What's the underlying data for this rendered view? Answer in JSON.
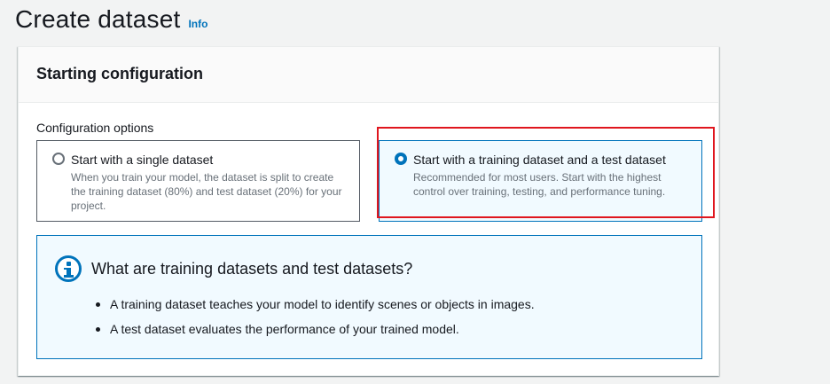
{
  "header": {
    "title": "Create dataset",
    "info_label": "Info"
  },
  "container": {
    "title": "Starting configuration"
  },
  "config": {
    "label": "Configuration options",
    "options": [
      {
        "title": "Start with a single dataset",
        "description": "When you train your model, the dataset is split to create the training dataset (80%) and test dataset (20%) for your project.",
        "selected": false
      },
      {
        "title": "Start with a training dataset and a test dataset",
        "description": "Recommended for most users. Start with the highest control over training, testing, and performance tuning.",
        "selected": true
      }
    ]
  },
  "alert": {
    "icon": "info-icon",
    "title": "What are training datasets and test datasets?",
    "items": [
      "A training dataset teaches your model to identify scenes or objects in images.",
      "A test dataset evaluates the performance of your trained model."
    ]
  },
  "colors": {
    "accent": "#0073bb",
    "highlight": "#e0161e",
    "selected_bg": "#f1faff"
  }
}
